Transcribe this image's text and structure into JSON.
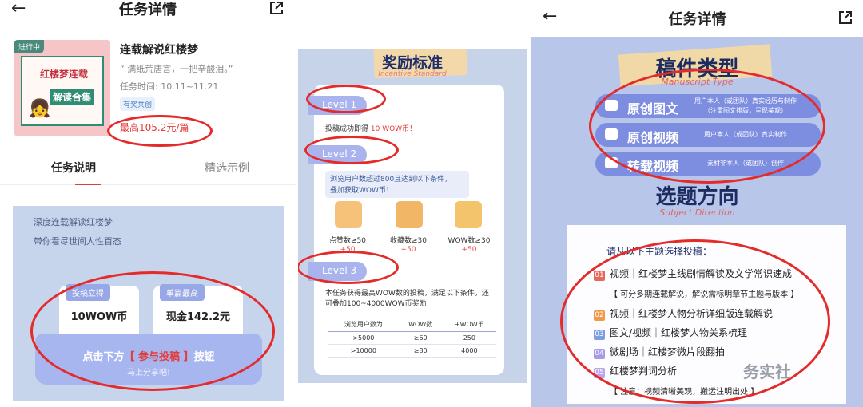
{
  "panel1": {
    "nav": {
      "back_icon": "←",
      "title": "任务详情"
    },
    "cover": {
      "status_tag": "进行中",
      "line1": "红楼梦连载",
      "line2": "解读合集"
    },
    "info": {
      "title": "连载解说红楼梦",
      "quote": "“ 满纸荒唐言，一把辛酸泪。”",
      "time": "任务时间: 10.11~11.21",
      "badge": "有奖共创",
      "price": "最高105.2元/篇"
    },
    "tabs": [
      {
        "label": "任务说明",
        "active": true
      },
      {
        "label": "精选示例",
        "active": false
      }
    ],
    "desc": {
      "line1": "深度连载解读红楼梦",
      "line2": "带你看尽世间人性百态",
      "cards": [
        {
          "title": "投稿立得",
          "value": "10WOW币"
        },
        {
          "title": "单篇最高",
          "value": "现金142.2元"
        }
      ],
      "cta_prefix": "点击下方",
      "cta_highlight": "【 参与投稿 】",
      "cta_suffix": "按钮",
      "cta_sub": "马上分享吧!"
    }
  },
  "panel2": {
    "title": "奖励标准",
    "subtitle": "Incentive Standard",
    "level1": {
      "label": "Level 1",
      "text_prefix": "投稿成功即得 ",
      "text_red": "10 WOW币！"
    },
    "level2": {
      "label": "Level 2",
      "box_line1": "浏览用户数超过800且达到以下条件，",
      "box_line2": "叠加获取WOW币！",
      "items": [
        {
          "label": "点赞数≥50",
          "value": "+50"
        },
        {
          "label": "收藏数≥30",
          "value": "+50"
        },
        {
          "label": "WOW数≥30",
          "value": "+50"
        }
      ]
    },
    "level3": {
      "label": "Level 3",
      "text_line1": "本任务获得最高WOW数的投稿，满足以下条件，还",
      "text_line2": "可叠加100~4000WOW币奖励",
      "table": {
        "headers": [
          "浏览用户数为",
          "WOW数",
          "+WOW币"
        ],
        "rows": [
          [
            ">5000",
            "≥60",
            "250"
          ],
          [
            ">10000",
            "≥80",
            "4000"
          ]
        ]
      }
    }
  },
  "panel3": {
    "nav": {
      "back_icon": "←",
      "title": "任务详情"
    },
    "type_title": "稿件类型",
    "type_subtitle": "Manuscript Type",
    "types": [
      {
        "name": "原创图文",
        "desc_line1": "用户本人（或团队）真实经历与制作",
        "desc_line2": "（注重图文排版，呈现美观）"
      },
      {
        "name": "原创视频",
        "desc_line1": "用户本人（或团队）真实制作",
        "desc_line2": ""
      },
      {
        "name": "转载视频",
        "desc_line1": "素材非本人（或团队）创作",
        "desc_line2": ""
      }
    ],
    "topic_title": "选题方向",
    "topic_subtitle": "Subject Direction",
    "intro": "请从以下主题选择投稿：",
    "topics": [
      {
        "num": "01",
        "text": "视频｜红楼梦主线剧情解读及文学常识速成"
      },
      {
        "num": "02",
        "text": "视频｜红楼梦人物分析详细版连载解说"
      },
      {
        "num": "03",
        "text": "图文/视频｜红楼梦人物关系梳理"
      },
      {
        "num": "04",
        "text": "微剧场｜红楼梦微片段翻拍"
      },
      {
        "num": "05",
        "text": "红楼梦判词分析"
      }
    ],
    "note1": "【 可分多期连载解说，解说需标明章节主题与版本 】",
    "note2": "【 注意：视频清晰美观，搬运注明出处 】",
    "watermark": "务实社"
  }
}
